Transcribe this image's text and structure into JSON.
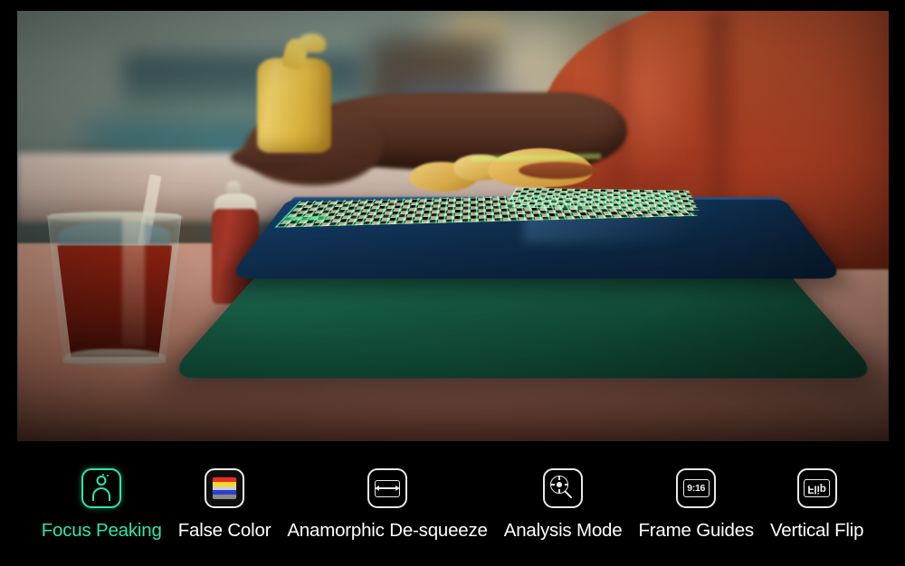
{
  "app": {
    "background_color": "#000000",
    "accent_color": "#2fe6a8",
    "inactive_color": "#ffffff"
  },
  "viewer": {
    "name": "camera-monitor-preview",
    "description": "Live camera monitor preview frame letterboxed on black",
    "focus_peaking_overlay_color": "#3dff9a",
    "scene": {
      "summary": "Diner interior, shallow depth of field. A person in an orange shirt holds a yellow mustard bottle over a table with a green cafeteria tray, a blue tray, checkered deli paper, a hot dog, a ketchup bottle and a glass of iced soda.",
      "elements": [
        "orange-shirt-sleeve",
        "reaching-arm-and-hand",
        "yellow-mustard-bottle",
        "red-ketchup-bottle",
        "glass-of-soda-with-straw",
        "blue-checkered-deli-paper",
        "hot-dog-in-bun",
        "fried-food-pieces",
        "blue-cafeteria-tray",
        "green-cafeteria-tray",
        "blurred-diner-background"
      ]
    }
  },
  "toolbar": {
    "name": "monitoring-tools-toolbar",
    "items": [
      {
        "id": "focus-peaking",
        "label": "Focus Peaking",
        "icon": "person-portrait-icon",
        "active": true,
        "icon_style": "teal-outline-rounded-square",
        "icon_color": "#2fe6a8"
      },
      {
        "id": "false-color",
        "label": "False Color",
        "icon": "color-bars-icon",
        "active": false,
        "icon_style": "filled-rounded-square-with-color-bars",
        "bars": [
          "#ee2b1d",
          "#f5d92b",
          "#cfcfcf",
          "#2b3fd4",
          "#8a8a8a"
        ]
      },
      {
        "id": "anamorphic-de-squeeze",
        "label": "Anamorphic De-squeeze",
        "icon": "horizontal-resize-arrows-icon",
        "active": false,
        "icon_style": "outline-rounded-square"
      },
      {
        "id": "analysis-mode",
        "label": "Analysis Mode",
        "icon": "magnifier-crosshair-icon",
        "active": false,
        "icon_style": "outline-rounded-square"
      },
      {
        "id": "frame-guides",
        "label": "Frame Guides",
        "icon": "aspect-ratio-icon",
        "icon_text": "9:16",
        "active": false,
        "icon_style": "outline-rounded-square"
      },
      {
        "id": "vertical-flip",
        "label": "Vertical Flip",
        "icon": "mirrored-text-icon",
        "icon_text": "Flip",
        "active": false,
        "icon_style": "outline-rounded-square"
      }
    ]
  }
}
